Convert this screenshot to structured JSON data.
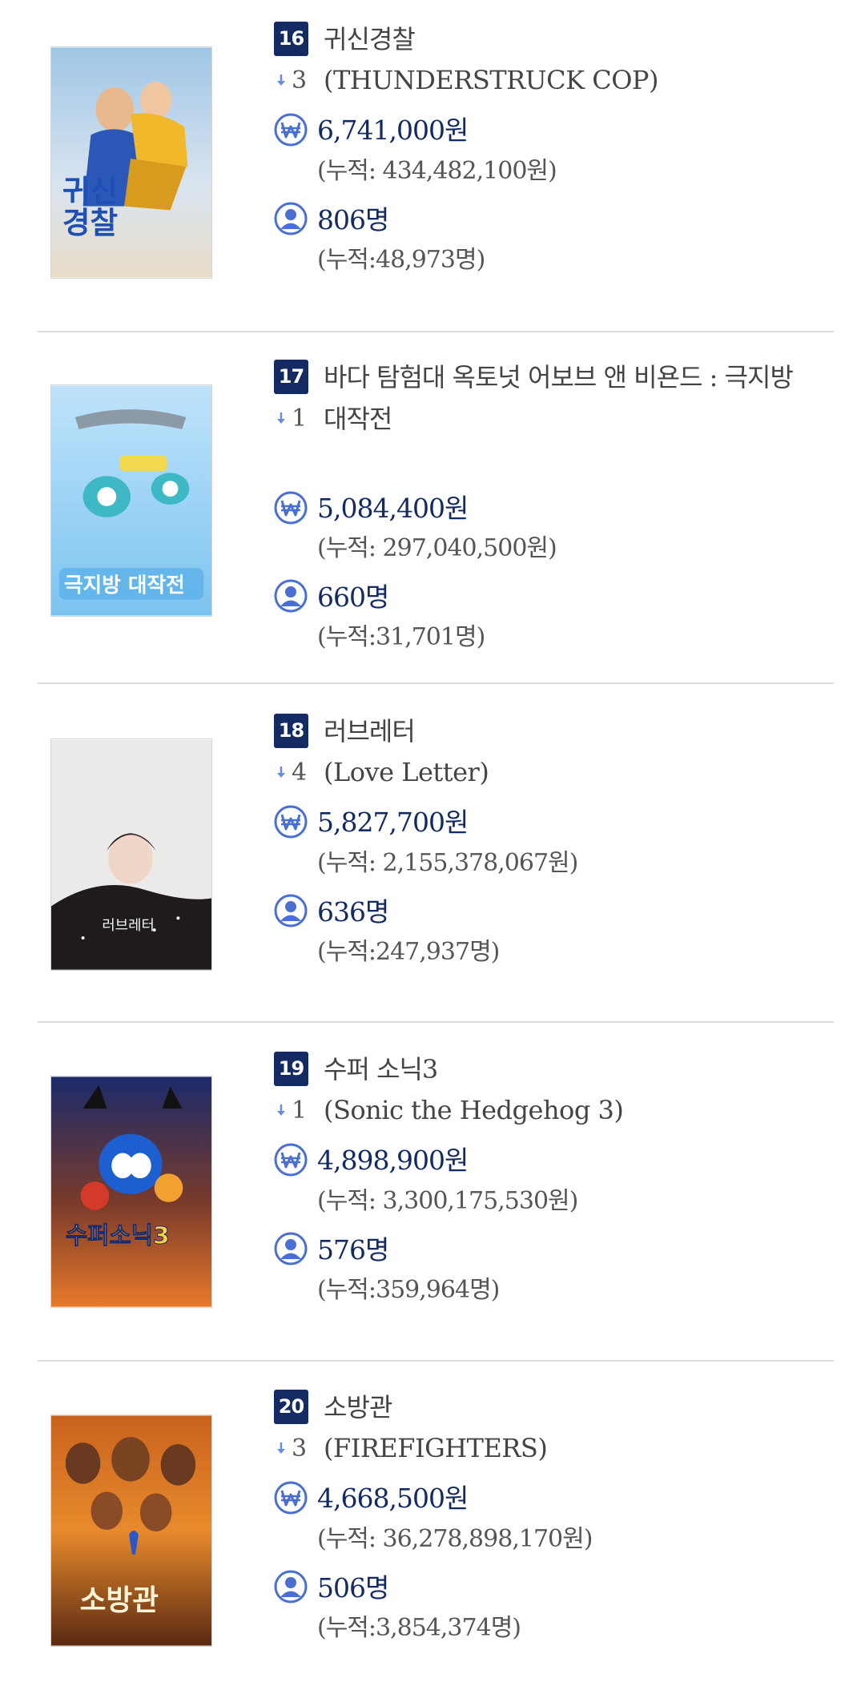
{
  "colors": {
    "badge": "#132a63",
    "icon": "#4a6fd3",
    "value_text": "#132a63",
    "secondary_text": "#555555",
    "divider": "#dcdcdc",
    "arrow": "#6b8be0"
  },
  "entries": [
    {
      "rank": "16",
      "title": "귀신경찰",
      "subtitle": "(THUNDERSTRUCK COP)",
      "rank_change": "3",
      "change_direction": "down",
      "sales": "6,741,000원",
      "sales_cumulative": "(누적: 434,482,100원)",
      "audience": "806명",
      "audience_cumulative": "(누적:48,973명)",
      "poster_icon": "poster-image",
      "poster_text": "귀신\n경찰"
    },
    {
      "rank": "17",
      "title": "바다 탐험대 옥토넛 어보브 앤 비욘드 : 극지방 대작전",
      "subtitle": "",
      "rank_change": "1",
      "change_direction": "down",
      "sales": "5,084,400원",
      "sales_cumulative": "(누적: 297,040,500원)",
      "audience": "660명",
      "audience_cumulative": "(누적:31,701명)",
      "poster_icon": "poster-image",
      "poster_text": "극지방 대작전"
    },
    {
      "rank": "18",
      "title": "러브레터",
      "subtitle": "(Love Letter)",
      "rank_change": "4",
      "change_direction": "down",
      "sales": "5,827,700원",
      "sales_cumulative": "(누적: 2,155,378,067원)",
      "audience": "636명",
      "audience_cumulative": "(누적:247,937명)",
      "poster_icon": "poster-image",
      "poster_text": "러브레터"
    },
    {
      "rank": "19",
      "title": "수퍼 소닉3",
      "subtitle": "(Sonic the Hedgehog 3)",
      "rank_change": "1",
      "change_direction": "down",
      "sales": "4,898,900원",
      "sales_cumulative": "(누적: 3,300,175,530원)",
      "audience": "576명",
      "audience_cumulative": "(누적:359,964명)",
      "poster_icon": "poster-image",
      "poster_text": "수퍼소닉3"
    },
    {
      "rank": "20",
      "title": "소방관",
      "subtitle": "(FIREFIGHTERS)",
      "rank_change": "3",
      "change_direction": "down",
      "sales": "4,668,500원",
      "sales_cumulative": "(누적: 36,278,898,170원)",
      "audience": "506명",
      "audience_cumulative": "(누적:3,854,374명)",
      "poster_icon": "poster-image",
      "poster_text": "소방관"
    }
  ]
}
